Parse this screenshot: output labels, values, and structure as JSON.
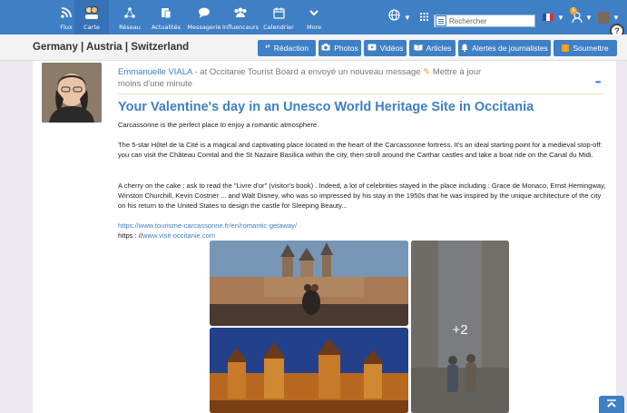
{
  "nav": {
    "items": [
      {
        "label": "Flux",
        "icon": "rss-icon"
      },
      {
        "label": "Carte",
        "icon": "map-people-icon"
      },
      {
        "label": "Réseau",
        "icon": "network-icon"
      },
      {
        "label": "Actualités",
        "icon": "news-icon"
      },
      {
        "label": "Messagerie",
        "icon": "chat-icon"
      },
      {
        "label": "Influenceurs",
        "icon": "group-icon"
      },
      {
        "label": "Calendrier",
        "icon": "calendar-icon"
      },
      {
        "label": "More",
        "icon": "chevron-down-icon"
      }
    ],
    "search_placeholder": "Rechercher",
    "badge_count": "5"
  },
  "subbar": {
    "region": "Germany | Austria | Switzerland",
    "tabs": [
      {
        "label": "Rédaction",
        "icon": "quote-icon"
      },
      {
        "label": "Photos",
        "icon": "camera-icon"
      },
      {
        "label": "Vidéos",
        "icon": "video-icon"
      },
      {
        "label": "Articles",
        "icon": "book-icon"
      },
      {
        "label": "Alertes de journalistes",
        "icon": "bell-icon"
      },
      {
        "label": "Soumettre",
        "icon": "submit-icon"
      }
    ]
  },
  "post": {
    "author": "Emmanuelle VIALA",
    "action": " - at Occitanie Tourist Board a envoyé un nouveau message ",
    "update_label": " Mettre à jour",
    "time": "moins d'une minute",
    "more": "•••",
    "title": "Your Valentine's day in an Unesco World Heritage Site in Occitania",
    "p1": "Carcassonne is the perfect place to enjoy a romantic atmosphere.",
    "p2": "The 5-star Hôtel de la Cité is a magical and captivating place located in the heart of the Carcassonne fortress. It's an ideal starting point for a medieval stop-off: you can visit the Château Comtal and the St Nazaire Basilica within the city, then stroll around the Carthar castles and take a boat ride on the Canal du Midi.",
    "p3": "A cherry on the cake : ask to read the \"Livre d'or\" (visitor's book) . Indeed, a lot of celebrities stayed in the place including : Grace de Monaco, Ernst Hemingway, Winston Churchill, Kevin Costner ... and Walt Disney, who was so impressed by his stay in the 1950s that he was inspired by the unique architecture of the city on his return to the United States to design the castle for Sleeping Beauty...",
    "link1": "https://www.tourisme-carcassonne.fr/en/romantic-getaway/",
    "link2_prefix": "https : //",
    "link2": "www.visit-occitanie.com",
    "more_photos": "+2"
  },
  "help_label": "?"
}
